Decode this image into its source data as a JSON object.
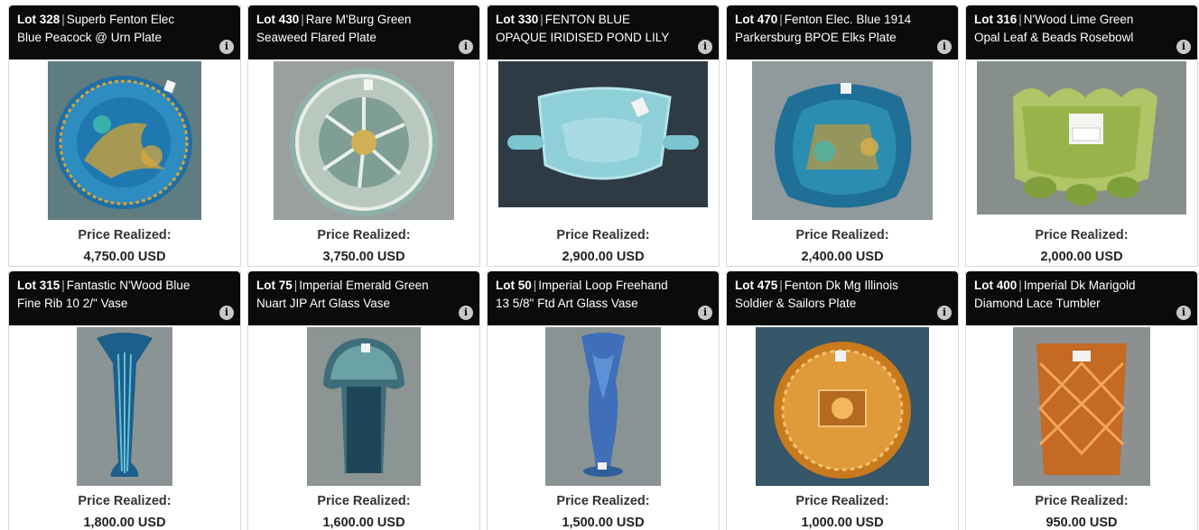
{
  "price_label": "Price Realized:",
  "info_glyph": "i",
  "lots": [
    {
      "lot": "Lot 328",
      "title_line1": "Superb Fenton Elec",
      "title_line2": "Blue Peacock @ Urn Plate",
      "price": "4,750.00",
      "currency": "USD",
      "image": "fenton-electric-blue-peacock-plate"
    },
    {
      "lot": "Lot 430",
      "title_line1": "Rare M'Burg Green",
      "title_line2": "Seaweed Flared Plate",
      "price": "3,750.00",
      "currency": "USD",
      "image": "millersburg-green-seaweed-plate"
    },
    {
      "lot": "Lot 330",
      "title_line1": "FENTON BLUE",
      "title_line2": "OPAQUE IRIDISED POND LILY",
      "price": "2,900.00",
      "currency": "USD",
      "image": "fenton-blue-opaque-pond-lily-bonbon"
    },
    {
      "lot": "Lot 470",
      "title_line1": "Fenton Elec. Blue 1914",
      "title_line2": "Parkersburg BPOE Elks Plate",
      "price": "2,400.00",
      "currency": "USD",
      "image": "fenton-elks-plate"
    },
    {
      "lot": "Lot 316",
      "title_line1": "N'Wood Lime Green",
      "title_line2": "Opal Leaf & Beads Rosebowl",
      "price": "2,000.00",
      "currency": "USD",
      "image": "northwood-lime-green-rosebowl"
    },
    {
      "lot": "Lot 315",
      "title_line1": "Fantastic N'Wood Blue",
      "title_line2": "Fine Rib 10 2/\" Vase",
      "price": "1,800.00",
      "currency": "USD",
      "image": "northwood-blue-fine-rib-vase"
    },
    {
      "lot": "Lot 75",
      "title_line1": "Imperial Emerald Green",
      "title_line2": "Nuart JIP Art Glass Vase",
      "price": "1,600.00",
      "currency": "USD",
      "image": "imperial-nuart-vase"
    },
    {
      "lot": "Lot 50",
      "title_line1": "Imperial Loop Freehand",
      "title_line2": "13 5/8\" Ftd Art Glass Vase",
      "price": "1,500.00",
      "currency": "USD",
      "image": "imperial-freehand-vase"
    },
    {
      "lot": "Lot 475",
      "title_line1": "Fenton Dk Mg Illinois",
      "title_line2": "Soldier & Sailors Plate",
      "price": "1,000.00",
      "currency": "USD",
      "image": "fenton-marigold-soldiers-sailors-plate"
    },
    {
      "lot": "Lot 400",
      "title_line1": "Imperial Dk Marigold",
      "title_line2": "Diamond Lace Tumbler",
      "price": "950.00",
      "currency": "USD",
      "image": "imperial-marigold-diamond-lace-tumbler"
    }
  ]
}
